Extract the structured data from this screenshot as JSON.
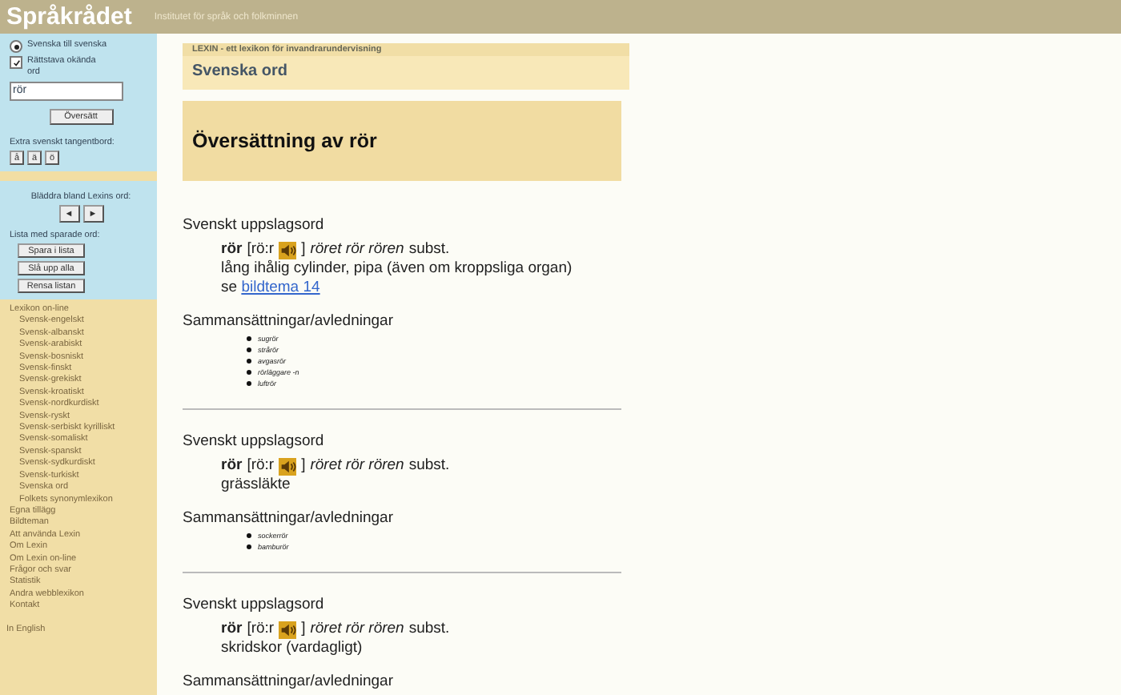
{
  "header": {
    "logo": "Språkrådet",
    "subtitle": "Institutet för språk och folkminnen"
  },
  "sidebar": {
    "options": [
      {
        "kind": "radio",
        "label": "Svenska till svenska",
        "checked": true
      },
      {
        "kind": "checkbox",
        "label": "Rättstava okända ord",
        "checked": true
      }
    ],
    "search": {
      "value": "rör"
    },
    "translate_button": "Översätt",
    "keyboard": {
      "label": "Extra svenskt tangentbord:",
      "keys": [
        "å",
        "ä",
        "ö"
      ]
    },
    "browse": {
      "label": "Bläddra bland Lexins ord:",
      "buttons": [
        "◄",
        "►"
      ]
    },
    "saved": {
      "label": "Lista med sparade ord:",
      "buttons": [
        "Spara i lista",
        "Slå upp alla",
        "Rensa listan"
      ]
    },
    "nav": [
      {
        "label": "Lexikon on-line",
        "children": [
          {
            "label": "Svensk-engelskt"
          },
          {
            "label": "Svensk-albanskt"
          },
          {
            "label": "Svensk-arabiskt"
          },
          {
            "label": "Svensk-bosniskt"
          },
          {
            "label": "Svensk-finskt"
          },
          {
            "label": "Svensk-grekiskt"
          },
          {
            "label": "Svensk-kroatiskt"
          },
          {
            "label": "Svensk-nordkurdiskt"
          },
          {
            "label": "Svensk-ryskt"
          },
          {
            "label": "Svensk-serbiskt kyrilliskt"
          },
          {
            "label": "Svensk-somaliskt"
          },
          {
            "label": "Svensk-spanskt"
          },
          {
            "label": "Svensk-sydkurdiskt"
          },
          {
            "label": "Svensk-turkiskt"
          },
          {
            "label": "Svenska ord"
          },
          {
            "label": "Folkets synonymlexikon"
          }
        ]
      },
      {
        "label": "Egna tillägg"
      },
      {
        "label": "Bildteman"
      },
      {
        "label": "Att använda Lexin"
      },
      {
        "label": "Om Lexin"
      },
      {
        "label": "Om Lexin on-line"
      },
      {
        "label": "Frågor och svar"
      },
      {
        "label": "Statistik"
      },
      {
        "label": "Andra webblexikon"
      },
      {
        "label": "Kontakt"
      }
    ],
    "language_link": "In English"
  },
  "main": {
    "breadcrumb": "LEXIN - ett lexikon för invandrarundervisning",
    "section_title": "Svenska ord",
    "heading": "Översättning av rör",
    "entries": [
      {
        "label": "Svenskt uppslagsord",
        "word": "rör",
        "pronunciation": "[rö:r",
        "bracket_close": "]",
        "inflections": "röret rör rören",
        "word_class": "subst.",
        "definition": "lång ihålig cylinder, pipa (även om kroppsliga organ)",
        "see": "se",
        "see_link": "bildtema 14",
        "compounds_label": "Sammansättningar/avledningar",
        "compounds": [
          "sugrör",
          "strårör",
          "avgasrör",
          "rörläggare -n",
          "luftrör"
        ]
      },
      {
        "label": "Svenskt uppslagsord",
        "word": "rör",
        "pronunciation": "[rö:r",
        "bracket_close": "]",
        "inflections": "röret rör rören",
        "word_class": "subst.",
        "definition": "grässläkte",
        "compounds_label": "Sammansättningar/avledningar",
        "compounds": [
          "sockerrör",
          "bamburör"
        ]
      },
      {
        "label": "Svenskt uppslagsord",
        "word": "rör",
        "pronunciation": "[rö:r",
        "bracket_close": "]",
        "inflections": "röret rör rören",
        "word_class": "subst.",
        "definition": "skridskor (vardagligt)",
        "compounds_label": "Sammansättningar/avledningar"
      }
    ]
  }
}
